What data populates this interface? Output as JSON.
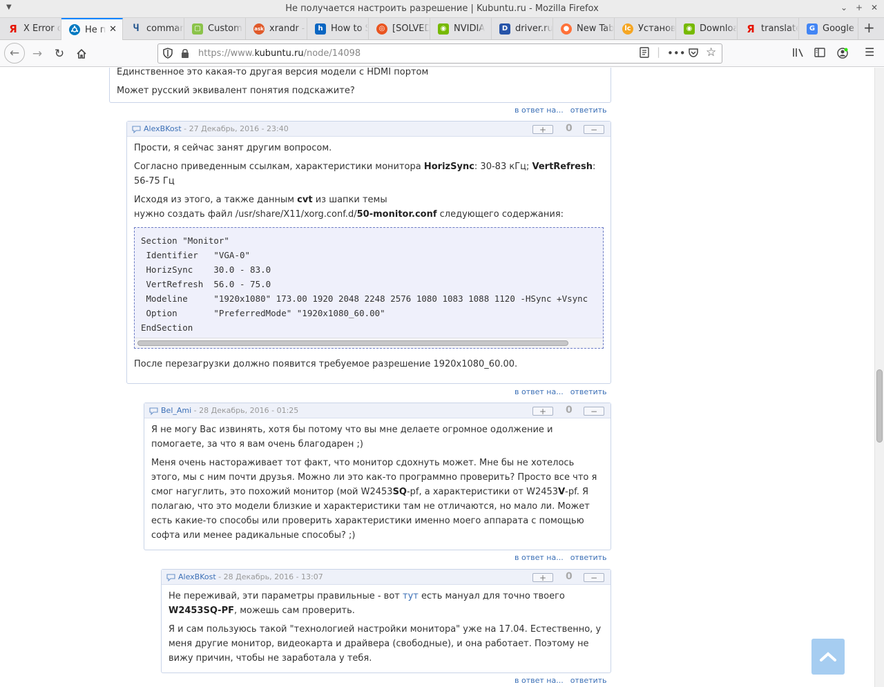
{
  "window": {
    "title": "Не получается настроить разрешение | Kubuntu.ru - Mozilla Firefox"
  },
  "tabs": [
    {
      "label": "X Error o",
      "icon": "yandex-icon",
      "color": "#e61400",
      "active": false
    },
    {
      "label": "Не п",
      "icon": "kubuntu-icon",
      "color": "#0079c1",
      "active": true
    },
    {
      "label": "comman",
      "icon": "unix-linux-icon",
      "color": "#1b4f8a",
      "active": false
    },
    {
      "label": "Custom",
      "icon": "custom-icon",
      "color": "#8bc34a",
      "active": false
    },
    {
      "label": "xrandr -",
      "icon": "askubuntu-icon",
      "color": "#e05a2b",
      "active": false
    },
    {
      "label": "How to S",
      "icon": "linkedin-icon",
      "color": "#0a66c2",
      "active": false
    },
    {
      "label": "[SOLVED",
      "icon": "ubuntu-icon",
      "color": "#e95420",
      "active": false
    },
    {
      "label": "NVIDIA",
      "icon": "nvidia-icon",
      "color": "#76b900",
      "active": false
    },
    {
      "label": "driver.ru",
      "icon": "driver-icon",
      "color": "#2754a8",
      "active": false
    },
    {
      "label": "New Tab",
      "icon": "firefox-icon",
      "color": "#ff7139",
      "active": false
    },
    {
      "label": "Установ",
      "icon": "lumpics-icon",
      "color": "#f5a623",
      "active": false
    },
    {
      "label": "Downloa",
      "icon": "nvidia-icon",
      "color": "#76b900",
      "active": false
    },
    {
      "label": "translate",
      "icon": "yandex-icon",
      "color": "#e61400",
      "active": false
    },
    {
      "label": "Google T",
      "icon": "google-translate-icon",
      "color": "#4285f4",
      "active": false
    }
  ],
  "toolbar": {
    "url_prefix": "https://www.",
    "url_host": "kubuntu.ru",
    "url_path": "/node/14098"
  },
  "page": {
    "top_comment": {
      "line1": "Единственное это какая-то другая версия модели с HDMI портом",
      "line2": "Может русский эквивалент понятия подскажите?"
    },
    "reply_to_label": "в ответ на...",
    "reply_label": "ответить",
    "comments": [
      {
        "author": "AlexBKost",
        "date": " - 27 Декабрь, 2016 - 23:40",
        "score": "0",
        "p1": " Прости, я сейчас занят другим вопросом.",
        "p2a": "Согласно приведенным ссылкам, характеристики монитора ",
        "p2b": "HorizSync",
        "p2c": ": 30-83 кГц; ",
        "p2d": "VertRefresh",
        "p2e": ": 56-75 Гц",
        "p3a": "Исходя из этого, а также данным ",
        "p3b": "cvt",
        "p3c": " из шапки темы",
        "p3d": "нужно создать файл /usr/share/X11/xorg.conf.d/",
        "p3e": "50-monitor.conf",
        "p3f": " следующего содержания:",
        "code": "Section \"Monitor\"\n Identifier   \"VGA-0\"\n HorizSync    30.0 - 83.0\n VertRefresh  56.0 - 75.0\n Modeline     \"1920x1080\" 173.00 1920 2048 2248 2576 1080 1083 1088 1120 -HSync +Vsync\n Option       \"PreferredMode\" \"1920x1080_60.00\"\nEndSection",
        "p4": "После перезагрузки должно появится требуемое разрешение 1920x1080_60.00."
      },
      {
        "author": "Bel_Ami",
        "date": " - 28 Декабрь, 2016 - 01:25",
        "score": "0",
        "p1": " Я не могу Вас извинять, хотя бы потому что вы мне делаете огромное одолжение и помогаете, за что я вам очень благодарен ;)",
        "p2a": "Меня очень настораживает тот факт, что монитор сдохнуть может. Мне бы не хотелось этого, мы с ним почти друзья. Можно ли это как-то программно проверить? Просто все что я смог нагуглить, это похожий монитор (мой W2453",
        "p2b": "SQ",
        "p2c": "-pf, а характеристики от W2453",
        "p2d": "V",
        "p2e": "-pf. Я полагаю, что это модели близкие и характеристики там не отличаются, но мало ли. Может есть какие-то способы или проверить характеристики именно моего аппарата с помощью софта или менее радикальные способы? ;)"
      },
      {
        "author": "AlexBKost",
        "date": " - 28 Декабрь, 2016 - 13:07",
        "score": "0",
        "p1a": " Не переживай, эти параметры правильные - вот ",
        "p1link": "тут",
        "p1b": " есть мануал для точно твоего ",
        "p1c": "W2453SQ-PF",
        "p1d": ", можешь сам проверить.",
        "p2": "Я и сам пользуюсь такой \"технологией настройки монитора\" уже на 17.04. Естественно, у меня другие монитор, видеокарта и драйвера (свободные), и она работает. Поэтому не вижу причин, чтобы не заработала у тебя."
      }
    ]
  },
  "colors": {
    "accent": "#0a84ff",
    "link": "#3b6fb6",
    "comment_header": "#eef1f9",
    "code_bg": "#eff0fb"
  }
}
